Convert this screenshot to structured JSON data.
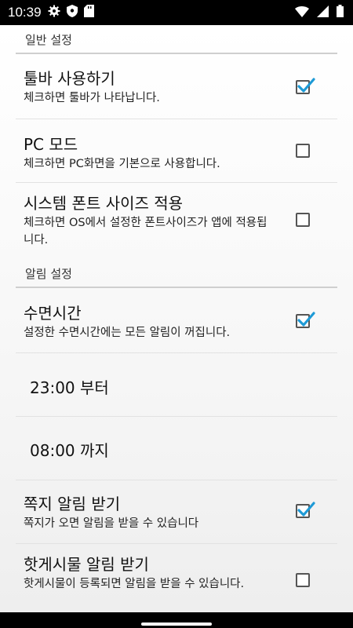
{
  "status_bar": {
    "time": "10:39",
    "left_icons": [
      "gear-icon",
      "shield-icon",
      "sd-card-icon"
    ],
    "right_icons": [
      "wifi-icon",
      "signal-icon",
      "battery-icon"
    ]
  },
  "sections": [
    {
      "header": "일반 설정",
      "items": [
        {
          "title": "툴바 사용하기",
          "summary": "체크하면 툴바가 나타납니다.",
          "checked": true
        },
        {
          "title": "PC 모드",
          "summary": "체크하면 PC화면을 기본으로 사용합니다.",
          "checked": false
        },
        {
          "title": "시스템 폰트 사이즈 적용",
          "summary": "체크하면 OS에서 설정한 폰트사이즈가 앱에 적용됩니다.",
          "checked": false
        }
      ]
    },
    {
      "header": "알림 설정",
      "items": [
        {
          "title": "수면시간",
          "summary": "설정한 수면시간에는 모든 알림이 꺼집니다.",
          "checked": true
        },
        {
          "title": "23:00 부터"
        },
        {
          "title": "08:00 까지"
        },
        {
          "title": "쪽지 알림 받기",
          "summary": "쪽지가 오면 알림을 받을 수 있습니다",
          "checked": true
        },
        {
          "title": "핫게시물 알림 받기",
          "summary": "핫게시물이 등록되면 알림을 받을 수 있습니다.",
          "checked": false
        }
      ]
    }
  ],
  "colors": {
    "check_accent": "#1e9ad6",
    "status_bar_bg": "#000000",
    "divider": "#cfcfcf"
  }
}
